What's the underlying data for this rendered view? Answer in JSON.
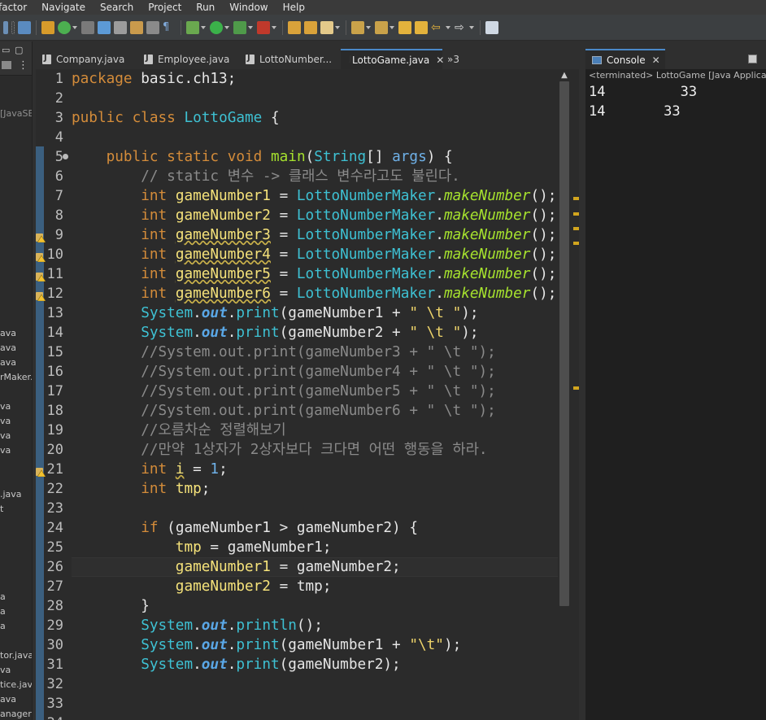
{
  "menu": [
    "factor",
    "Navigate",
    "Search",
    "Project",
    "Run",
    "Window",
    "Help"
  ],
  "editor": {
    "tabs": [
      {
        "label": "Company.java",
        "active": false
      },
      {
        "label": "Employee.java",
        "active": false
      },
      {
        "label": "LottoNumber...",
        "active": false
      },
      {
        "label": "LottoGame.java",
        "active": true
      }
    ],
    "overflow": "»3"
  },
  "left_panel": {
    "items": [
      "[JavaSE",
      "ava",
      "ava",
      "ava",
      "rMaker.",
      "va",
      "va",
      "va",
      "va",
      ".java",
      "t",
      "a",
      "a",
      "a",
      "tor.java",
      "va",
      "tice.java",
      "ava",
      "anager"
    ]
  },
  "code_lines": [
    {
      "n": "1",
      "html": "<span class='kw'>package</span> basic.ch13;"
    },
    {
      "n": "2",
      "html": ""
    },
    {
      "n": "3",
      "html": "<span class='kw'>public</span> <span class='kw'>class</span> <span class='cls'>LottoGame</span> {"
    },
    {
      "n": "4",
      "html": ""
    },
    {
      "n": "5",
      "html": "    <span class='kw'>public</span> <span class='kw'>static</span> <span class='kw'>void</span> <span class='fn2'>main</span>(<span class='cls'>String</span>[] <span class='num'>args</span>) {"
    },
    {
      "n": "6",
      "html": "        <span class='cmt'>// static 변수 -&gt; 클래스 변수라고도 불린다.</span>"
    },
    {
      "n": "7",
      "html": "        <span class='kw'>int</span> <span class='var'>gameNumber1</span> = <span class='cls'>LottoNumberMaker</span>.<span class='fn'>makeNumber</span>();"
    },
    {
      "n": "8",
      "html": "        <span class='kw'>int</span> <span class='var'>gameNumber2</span> = <span class='cls'>LottoNumberMaker</span>.<span class='fn'>makeNumber</span>();"
    },
    {
      "n": "9",
      "html": "        <span class='kw'>int</span> <span class='var-u'>gameNumber3</span> = <span class='cls'>LottoNumberMaker</span>.<span class='fn'>makeNumber</span>();"
    },
    {
      "n": "10",
      "html": "        <span class='kw'>int</span> <span class='var-u'>gameNumber4</span> = <span class='cls'>LottoNumberMaker</span>.<span class='fn'>makeNumber</span>();"
    },
    {
      "n": "11",
      "html": "        <span class='kw'>int</span> <span class='var-u'>gameNumber5</span> = <span class='cls'>LottoNumberMaker</span>.<span class='fn'>makeNumber</span>();"
    },
    {
      "n": "12",
      "html": "        <span class='kw'>int</span> <span class='var-u'>gameNumber6</span> = <span class='cls'>LottoNumberMaker</span>.<span class='fn'>makeNumber</span>();"
    },
    {
      "n": "13",
      "html": "        <span class='cls'>System</span>.<span class='fld'>out</span>.<span class='mtd'>print</span>(gameNumber1 + <span class='str'>\" \\t \"</span>);"
    },
    {
      "n": "14",
      "html": "        <span class='cls'>System</span>.<span class='fld'>out</span>.<span class='mtd'>print</span>(gameNumber2 + <span class='str'>\" \\t \"</span>);"
    },
    {
      "n": "15",
      "html": "        <span class='cmt'>//System.out.print(gameNumber3 + \" \\t \");</span>"
    },
    {
      "n": "16",
      "html": "        <span class='cmt'>//System.out.print(gameNumber4 + \" \\t \");</span>"
    },
    {
      "n": "17",
      "html": "        <span class='cmt'>//System.out.print(gameNumber5 + \" \\t \");</span>"
    },
    {
      "n": "18",
      "html": "        <span class='cmt'>//System.out.print(gameNumber6 + \" \\t \");</span>"
    },
    {
      "n": "19",
      "html": "        <span class='cmt'>//오름차순 정렬해보기</span>"
    },
    {
      "n": "20",
      "html": "        <span class='cmt'>//만약 1상자가 2상자보다 크다면 어떤 행동을 하라.</span>"
    },
    {
      "n": "21",
      "html": "        <span class='kw'>int</span> <span class='var-u'>i</span> = <span class='num'>1</span>;"
    },
    {
      "n": "22",
      "html": "        <span class='kw'>int</span> <span class='var'>tmp</span>;"
    },
    {
      "n": "23",
      "html": ""
    },
    {
      "n": "24",
      "html": "        <span class='kw'>if</span> (gameNumber1 &gt; gameNumber2) {"
    },
    {
      "n": "25",
      "html": "            <span class='var'>tmp</span> = gameNumber1;"
    },
    {
      "n": "26",
      "html": "            <span class='var'>gameNumber1</span> = gameNumber2;"
    },
    {
      "n": "27",
      "html": "            <span class='var'>gameNumber2</span> = tmp;"
    },
    {
      "n": "28",
      "html": "        }"
    },
    {
      "n": "29",
      "html": "        <span class='cls'>System</span>.<span class='fld'>out</span>.<span class='mtd'>println</span>();"
    },
    {
      "n": "30",
      "html": "        <span class='cls'>System</span>.<span class='fld'>out</span>.<span class='mtd'>print</span>(gameNumber1 + <span class='str'>\"\\t\"</span>);"
    },
    {
      "n": "31",
      "html": "        <span class='cls'>System</span>.<span class='fld'>out</span>.<span class='mtd'>print</span>(gameNumber2);"
    },
    {
      "n": "32",
      "html": ""
    },
    {
      "n": "33",
      "html": ""
    },
    {
      "n": "34",
      "html": ""
    }
  ],
  "warning_lines": [
    "9",
    "10",
    "11",
    "12",
    "21"
  ],
  "console": {
    "tab_label": "Console",
    "title": "<terminated> LottoGame [Java Application]",
    "output": [
      "14         33",
      "14       33"
    ]
  },
  "colors": {
    "accent": "#4a88c7",
    "warning": "#d2a51e"
  }
}
